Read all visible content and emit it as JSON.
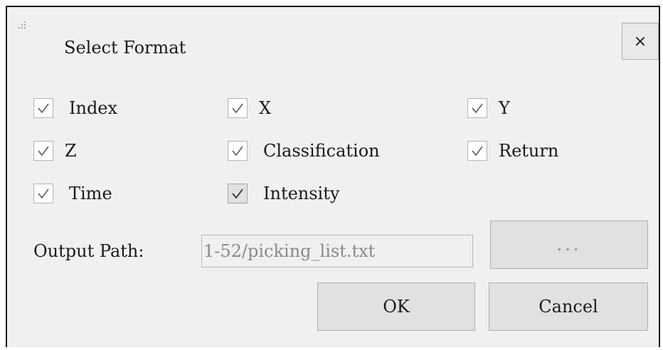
{
  "dialog": {
    "title": "Select Format",
    "close_symbol": "×",
    "close_icon": "close-icon",
    "grip_icon": "drag-grip-icon"
  },
  "options": [
    {
      "label": "Index",
      "checked": true
    },
    {
      "label": "X",
      "checked": true
    },
    {
      "label": "Y",
      "checked": true
    },
    {
      "label": "Z",
      "checked": true
    },
    {
      "label": "Classification",
      "checked": true
    },
    {
      "label": "Return",
      "checked": true
    },
    {
      "label": "Time",
      "checked": true
    },
    {
      "label": "Intensity",
      "checked": true,
      "hovered": true
    }
  ],
  "output": {
    "label": "Output Path:",
    "value": "1-52/picking_list.txt",
    "browse_label": "..."
  },
  "buttons": {
    "ok_label": "OK",
    "cancel_label": "Cancel"
  },
  "colors": {
    "dialog_bg": "#f0f0f0",
    "button_bg": "#e1e1e1",
    "disabled_text": "#8a8a8a"
  }
}
